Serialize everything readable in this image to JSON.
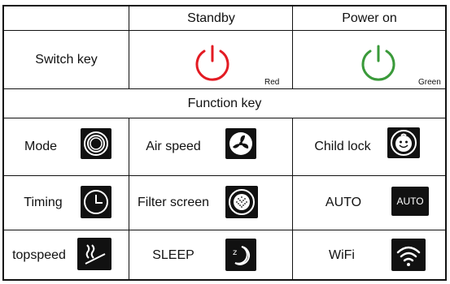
{
  "header": {
    "standby": "Standby",
    "power_on": "Power on"
  },
  "switch_row": {
    "label": "Switch key",
    "standby_color_label": "Red",
    "power_on_color_label": "Green",
    "standby_color": "#e31b23",
    "power_on_color": "#3a9a3a"
  },
  "function_header": "Function key",
  "functions": [
    {
      "label": "Mode",
      "icon": "mode-icon"
    },
    {
      "label": "Air speed",
      "icon": "fan-icon"
    },
    {
      "label": "Child lock",
      "icon": "child-lock-icon"
    },
    {
      "label": "Timing",
      "icon": "clock-icon"
    },
    {
      "label": "Filter screen",
      "icon": "filter-icon"
    },
    {
      "label": "AUTO",
      "icon": "auto-icon",
      "icon_text": "AUTO"
    },
    {
      "label": "topspeed",
      "icon": "topspeed-icon"
    },
    {
      "label": "SLEEP",
      "icon": "sleep-icon"
    },
    {
      "label": "WiFi",
      "icon": "wifi-icon"
    }
  ]
}
